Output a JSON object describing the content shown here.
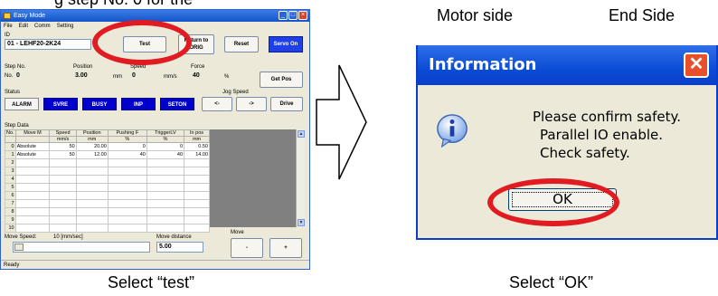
{
  "captions": {
    "top_left": "g step No. 0 for the",
    "top_mid": "Motor  side",
    "top_right": "End Side",
    "bottom_left": "Select “test”",
    "bottom_right": "Select “OK”"
  },
  "left_window": {
    "title": "Easy Mode",
    "menu": [
      "File",
      "Edit",
      "Comm",
      "Setting"
    ],
    "id_label": "ID",
    "id_value": "01 - LEHF20-2K24",
    "buttons": {
      "test": "Test",
      "return_to_origin": "Return to ORIG",
      "reset": "Reset",
      "servo_on": "Servo On",
      "get_pos": "Get Pos",
      "drive": "Drive",
      "jog_left": "<-",
      "jog_right": "->",
      "move_minus": "-",
      "move_plus": "+"
    },
    "step_no": {
      "label": "Step No.",
      "prefix": "No.",
      "value": "0"
    },
    "position": {
      "label": "Position",
      "value": "3.00",
      "unit": "mm"
    },
    "speed": {
      "label": "Speed",
      "value": "0",
      "unit": "mm/s"
    },
    "force": {
      "label": "Force",
      "value": "40",
      "unit": "%"
    },
    "status_label": "Status",
    "status_lamps": [
      "ALARM",
      "SVRE",
      "BUSY",
      "INP",
      "SETON"
    ],
    "jog_speed_label": "Jog Speed",
    "step_data_label": "Step Data",
    "table": {
      "headers": [
        [
          "No.",
          "Move M",
          "Speed",
          "Position",
          "Pushing F",
          "TriggerLV",
          "In pos"
        ],
        [
          "",
          "",
          "mm/s",
          "mm",
          "%",
          "%",
          "mm"
        ]
      ],
      "rows": [
        [
          "0",
          "Absolute",
          "50",
          "20.00",
          "0",
          "0",
          "0.50"
        ],
        [
          "1",
          "Absolute",
          "50",
          "12.00",
          "40",
          "40",
          "14.00"
        ],
        [
          "2",
          "",
          "",
          "",
          "",
          "",
          ""
        ],
        [
          "3",
          "",
          "",
          "",
          "",
          "",
          ""
        ],
        [
          "4",
          "",
          "",
          "",
          "",
          "",
          ""
        ],
        [
          "5",
          "",
          "",
          "",
          "",
          "",
          ""
        ],
        [
          "6",
          "",
          "",
          "",
          "",
          "",
          ""
        ],
        [
          "7",
          "",
          "",
          "",
          "",
          "",
          ""
        ],
        [
          "8",
          "",
          "",
          "",
          "",
          "",
          ""
        ],
        [
          "9",
          "",
          "",
          "",
          "",
          "",
          ""
        ],
        [
          "10",
          "",
          "",
          "",
          "",
          "",
          ""
        ]
      ]
    },
    "move_speed_label": "Move Speed:",
    "move_speed_value": "10 [mm/sec]",
    "move_distance_label": "Move distance",
    "move_distance_value": "5.00",
    "move_label": "Move",
    "status_bar": "Ready"
  },
  "dialog": {
    "title": "Information",
    "lines": [
      "Please confirm safety.",
      "Parallel IO enable.",
      "Check safety."
    ],
    "ok": "OK"
  },
  "colors": {
    "highlight_ring": "#e11b22",
    "titlebar": "#0b4cd6",
    "status_on": "#0000cc"
  }
}
